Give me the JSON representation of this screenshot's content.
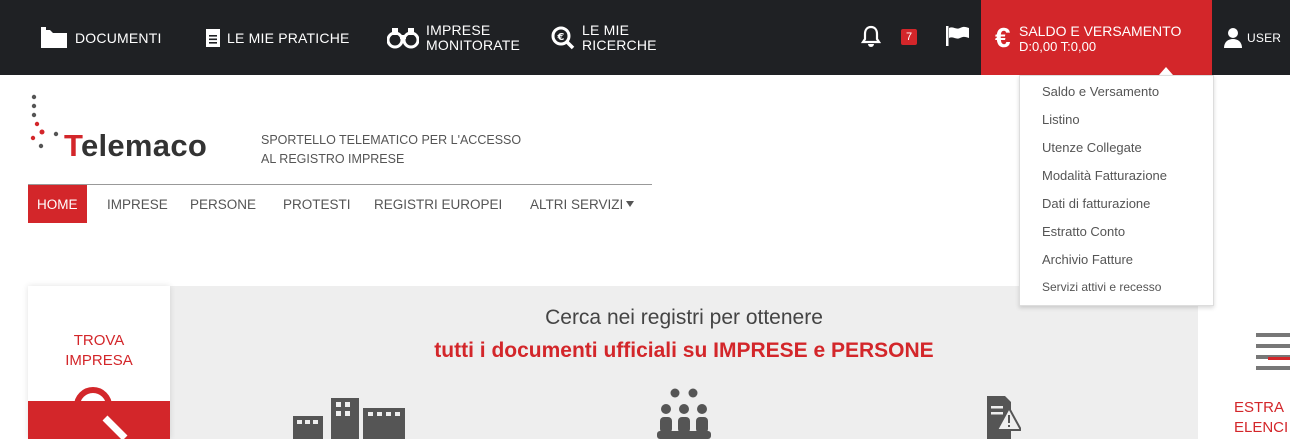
{
  "topbar": {
    "items": [
      {
        "label": "DOCUMENTI",
        "icon": "folder-icon"
      },
      {
        "label": "LE MIE PRATICHE",
        "icon": "document-icon"
      },
      {
        "label": "IMPRESE",
        "label2": "MONITORATE",
        "icon": "binoculars-icon"
      },
      {
        "label": "LE MIE",
        "label2": "RICERCHE",
        "icon": "search-euro-icon"
      }
    ],
    "notification_count": "7",
    "saldo": {
      "title": "SALDO E VERSAMENTO",
      "values": "D:0,00 T:0,00"
    },
    "user_label": "USER"
  },
  "dropdown": {
    "items": [
      "Saldo e Versamento",
      "Listino",
      "Utenze Collegate",
      "Modalità Fatturazione",
      "Dati di fatturazione",
      "Estratto Conto",
      "Archivio Fatture",
      "Servizi attivi e recesso"
    ]
  },
  "header": {
    "logo_text_prefix": "T",
    "logo_text_rest": "elemaco",
    "tagline_line1": "SPORTELLO TELEMATICO PER L'ACCESSO",
    "tagline_line2": "AL REGISTRO IMPRESE"
  },
  "nav": {
    "items": [
      "HOME",
      "IMPRESE",
      "PERSONE",
      "PROTESTI",
      "REGISTRI EUROPEI",
      "ALTRI SERVIZI"
    ]
  },
  "content": {
    "left_card_line1": "TROVA",
    "left_card_line2": "IMPRESA",
    "headline_line1": "Cerca nei registri per ottenere",
    "headline_line2": "tutti i documenti ufficiali su IMPRESE e PERSONE",
    "right_card_line1": "ESTRA",
    "right_card_line2": "ELENCI"
  },
  "colors": {
    "accent": "#d3262a",
    "topbar": "#1f2124",
    "panel": "#eeeeee"
  }
}
